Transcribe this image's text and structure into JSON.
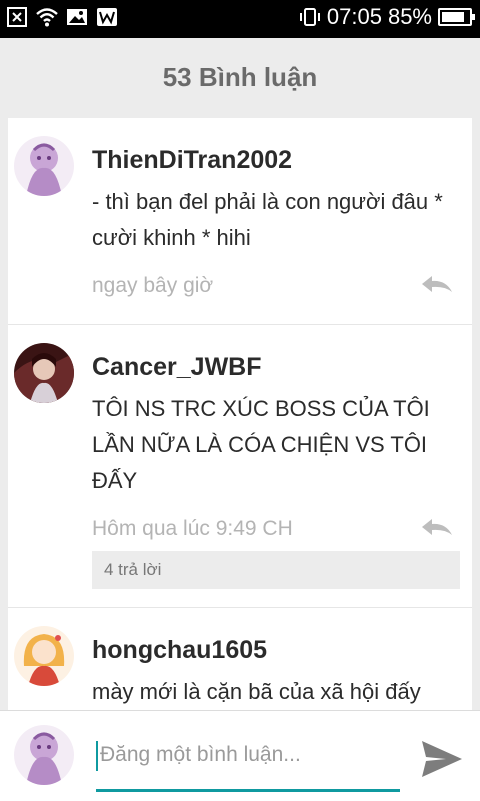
{
  "status_bar": {
    "time": "07:05",
    "battery_percent": "85%",
    "battery_level": 0.85,
    "icons": [
      "close-box-icon",
      "wifi-icon",
      "image-icon",
      "w-app-icon",
      "phone-vibrate-icon",
      "battery-icon"
    ]
  },
  "header": {
    "title": "53 Bình luận"
  },
  "comments": [
    {
      "username": "ThienDiTran2002",
      "text": "- thì bạn đel phải là con người đâu * cười khinh * hihi",
      "time": "ngay bây giờ",
      "avatar_color": "#c9a6d6"
    },
    {
      "username": "Cancer_JWBF",
      "text": "TÔI NS  TRC XÚC BOSS CỦA TÔI LẦN NỮA LÀ CÓA CHIỆN VS TÔI ĐẤY",
      "time": "Hôm qua lúc 9:49 CH",
      "replies_label": "4 trả lời",
      "avatar_color": "#5a2a2a"
    },
    {
      "username": "hongchau1605",
      "text": "mày mới là cặn bã của xã hội đấy",
      "time": "",
      "avatar_color": "#f0b060"
    }
  ],
  "composer": {
    "placeholder": "Đăng một bình luận...",
    "value": ""
  },
  "colors": {
    "accent": "#0f9aa0",
    "header_bg": "#ececec",
    "muted_text": "#b4b4b4"
  }
}
